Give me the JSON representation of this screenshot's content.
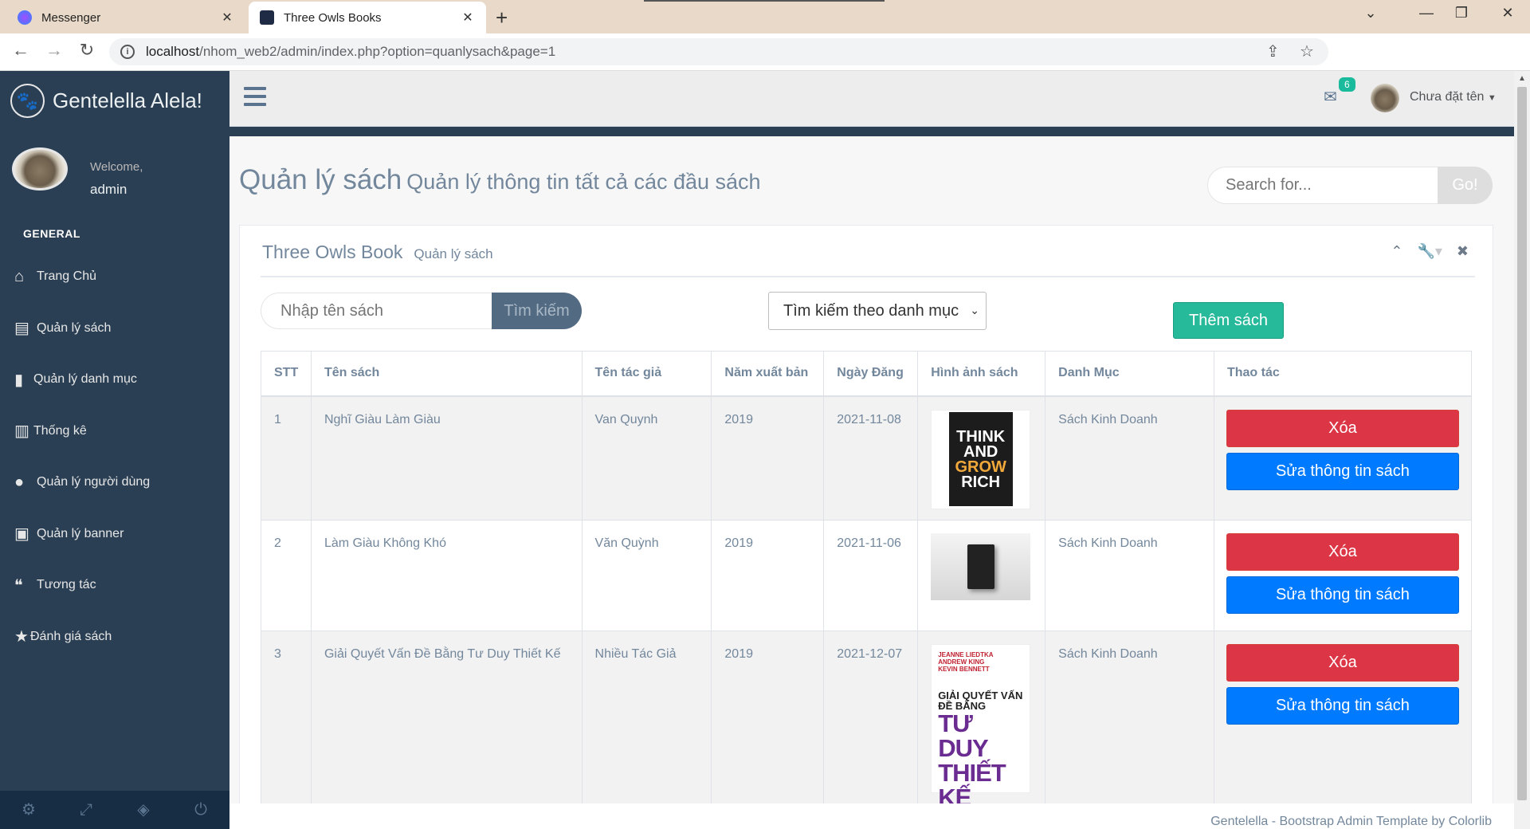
{
  "browser": {
    "tabs": [
      {
        "title": "Messenger",
        "active": false,
        "icon": "messenger-icon"
      },
      {
        "title": "Three Owls Books",
        "active": true,
        "icon": "owl-icon"
      }
    ],
    "url_host": "localhost",
    "url_path": "/nhom_web2/admin/index.php?option=quanlysach&page=1"
  },
  "sidebar": {
    "brand": "Gentelella Alela!",
    "welcome": "Welcome,",
    "username": "admin",
    "section": "GENERAL",
    "items": [
      {
        "label": "Trang Chủ",
        "icon": "home-icon"
      },
      {
        "label": "Quản lý sách",
        "icon": "book-icon"
      },
      {
        "label": "Quản lý danh mục",
        "icon": "bookmark-icon"
      },
      {
        "label": "Thống kê",
        "icon": "bar-chart-icon"
      },
      {
        "label": "Quản lý người dùng",
        "icon": "user-icon"
      },
      {
        "label": "Quản lý banner",
        "icon": "image-icon"
      },
      {
        "label": "Tương tác",
        "icon": "comments-icon"
      },
      {
        "label": "Đánh giá sách",
        "icon": "star-icon"
      }
    ]
  },
  "topnav": {
    "mail_count": "6",
    "user_name": "Chưa đặt tên"
  },
  "page": {
    "title": "Quản lý sách",
    "subtitle": "Quản lý thông tin tất cả các đầu sách",
    "search_placeholder": "Search for...",
    "search_button": "Go!"
  },
  "panel": {
    "title": "Three Owls Book",
    "subtitle": "Quản lý sách",
    "name_placeholder": "Nhập tên sách",
    "name_button": "Tìm kiếm",
    "category_select": "Tìm kiếm theo danh mục",
    "add_button": "Thêm sách"
  },
  "table": {
    "headers": [
      "STT",
      "Tên sách",
      "Tên tác giả",
      "Năm xuất bản",
      "Ngày Đăng",
      "Hình ảnh sách",
      "Danh Mục",
      "Thao tác"
    ],
    "rows": [
      {
        "stt": "1",
        "name": "Nghĩ Giàu Làm Giàu",
        "author": "Van Quynh",
        "year": "2019",
        "date": "2021-11-08",
        "category": "Sách Kinh Doanh",
        "delete": "Xóa",
        "edit": "Sửa thông tin sách"
      },
      {
        "stt": "2",
        "name": "Làm Giàu Không Khó",
        "author": "Văn Quỳnh",
        "year": "2019",
        "date": "2021-11-06",
        "category": "Sách Kinh Doanh",
        "delete": "Xóa",
        "edit": "Sửa thông tin sách"
      },
      {
        "stt": "3",
        "name": "Giải Quyết Vấn Đề Bằng Tư Duy Thiết Kế",
        "author": "Nhiều Tác Giả",
        "year": "2019",
        "date": "2021-12-07",
        "category": "Sách Kinh Doanh",
        "delete": "Xóa",
        "edit": "Sửa thông tin sách"
      }
    ]
  },
  "covers": {
    "c1": [
      "THINK",
      "AND",
      "GROW",
      "RICH"
    ],
    "c3_authors": "JEANNE LIEDTKA\nANDREW KING\nKEVIN BENNETT",
    "c3_title": "GIẢI QUYẾT VẤN ĐỀ BẰNG",
    "c3_big": "TƯ DUY THIẾT KẾ"
  },
  "footer": {
    "text": "Gentelella - Bootstrap Admin Template by Colorlib"
  },
  "colors": {
    "sidebar_bg": "#2a3f54",
    "accent_green": "#26b99a",
    "danger": "#dc3545",
    "primary": "#007bff"
  }
}
